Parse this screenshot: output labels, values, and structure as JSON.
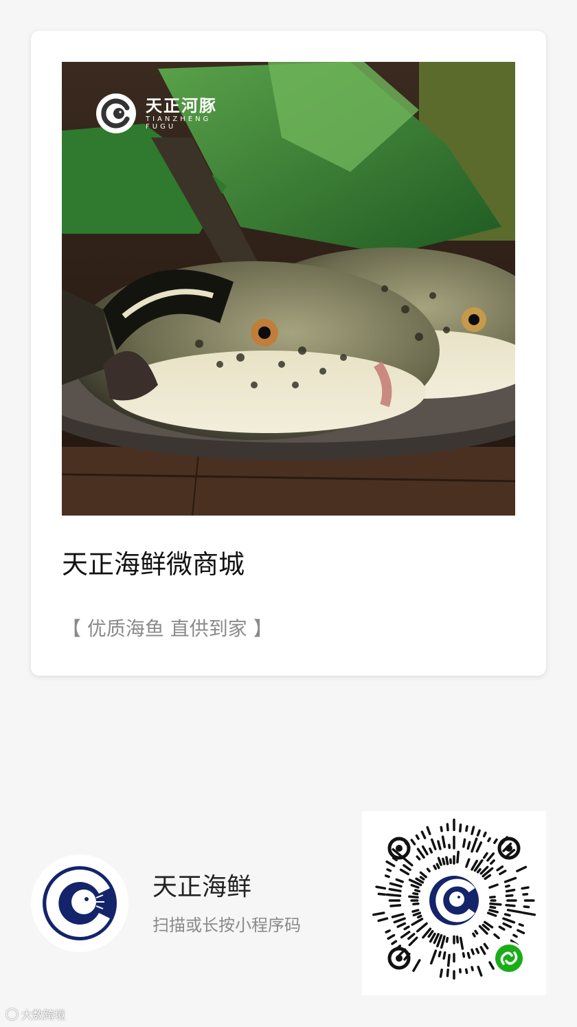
{
  "card": {
    "title": "天正海鲜微商城",
    "subtitle": "【 优质海鱼 直供到家 】",
    "photo": {
      "brand_cn": "天正河豚",
      "brand_en_line1": "TIANZHENG",
      "brand_en_line2": "FUGU",
      "icon": "pufferfish-logo-icon"
    }
  },
  "footer": {
    "shop_name": "天正海鲜",
    "hint": "扫描或长按小程序码",
    "avatar_icon": "pufferfish-logo-icon",
    "qr_icon": "mini-program-code-icon",
    "qr_badge_icon": "mini-program-link-icon"
  },
  "watermark": {
    "text": "大数跨境"
  },
  "colors": {
    "brand_navy": "#14246b",
    "mini_program_green": "#1aad19",
    "background": "#f6f6f6"
  }
}
